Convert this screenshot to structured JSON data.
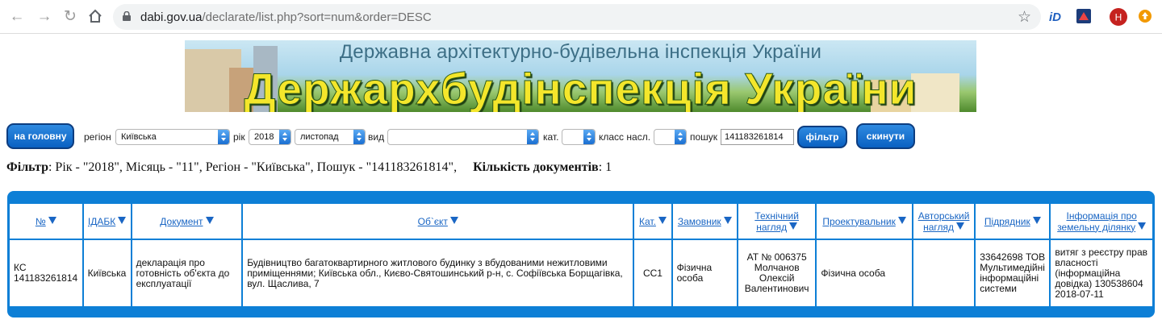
{
  "browser": {
    "url_host": "dabi.gov.ua",
    "url_path": "/declarate/list.php?sort=num&order=DESC",
    "profile_initial": "Н"
  },
  "banner": {
    "subtitle": "Державна архітектурно-будівельна інспекція України",
    "title": "Держархбудінспекція України"
  },
  "filters": {
    "home_button": "на головну",
    "region_label": "регіон",
    "region_value": "Київська",
    "year_label": "рік",
    "year_value": "2018",
    "month_value": "листопад",
    "type_label": "вид",
    "type_value": "",
    "category_label": "кат.",
    "category_value": "",
    "class_label": "класс насл.",
    "class_value": "",
    "search_label": "пошук",
    "search_value": "141183261814",
    "filter_button": "фільтр",
    "reset_button": "скинути"
  },
  "summary": {
    "filter_label": "Фільтр",
    "filter_text": ": Рік - \"2018\", Місяць - \"11\", Регіон - \"Київська\", Пошук - \"141183261814\",",
    "count_label": "Кількість документів",
    "count_text": ": 1"
  },
  "table": {
    "headers": {
      "num": "№",
      "idabk": "ІДАБК",
      "document": "Документ",
      "object": "Об`єкт",
      "category": "Кат.",
      "customer": "Замовник",
      "technical_supervision": "Технічний нагляд",
      "designer": "Проектувальник",
      "author_supervision": "Авторський нагляд",
      "contractor": "Підрядник",
      "land_info": "Інформація про земельну ділянку"
    },
    "rows": [
      {
        "num": "КС 141183261814",
        "idabk": "Київська",
        "document": "декларація про готовність об'єкта до експлуатації",
        "object": "Будівництво багатоквартирного житлового будинку з вбудованими нежитловими приміщеннями; Київська обл., Києво-Святошинський р-н, с. Софіївська Борщагівка, вул. Щаслива, 7",
        "category": "СС1",
        "customer": "Фізична особа",
        "technical_supervision": "АТ № 006375 Молчанов Олексій Валентинович",
        "designer": "Фізична особа",
        "author_supervision": "",
        "contractor": "33642698 ТОВ Мультимедійні інформаційні системи",
        "land_info": "витяг з реєстру прав власності (інформаційна довідка) 130538604 2018-07-11"
      }
    ]
  }
}
